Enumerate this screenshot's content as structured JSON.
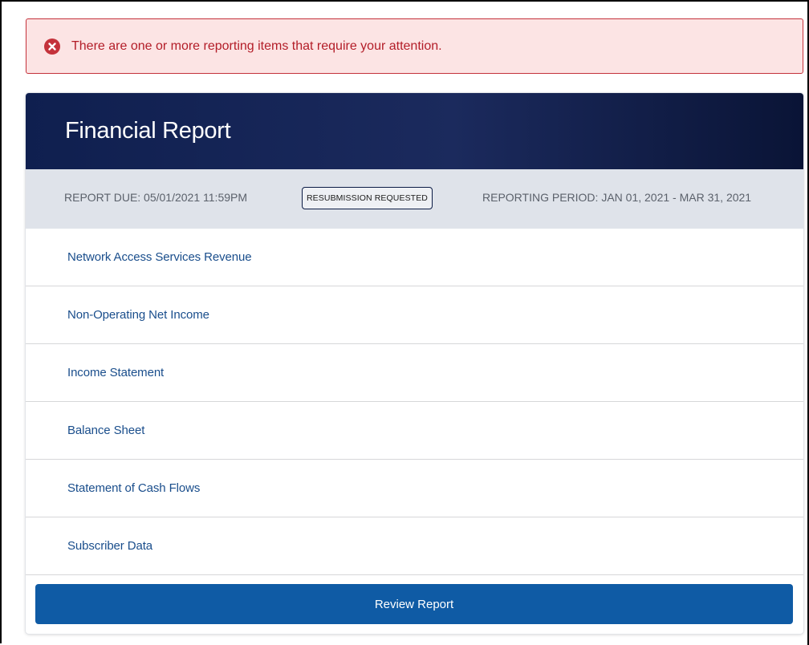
{
  "alert": {
    "icon": "error-circle-icon",
    "message": "There are one or more reporting items that require your attention.",
    "color": "#b31d28",
    "background": "#fce4e4"
  },
  "report": {
    "title": "Financial Report",
    "due": "REPORT DUE: 05/01/2021 11:59PM",
    "status": "RESUBMISSION REQUESTED",
    "period": "REPORTING PERIOD: JAN 01, 2021 - MAR 31, 2021",
    "header_color": "#0f1f4f"
  },
  "items": [
    {
      "label": "Network Access Services Revenue"
    },
    {
      "label": "Non-Operating Net Income"
    },
    {
      "label": "Income Statement"
    },
    {
      "label": "Balance Sheet"
    },
    {
      "label": "Statement of Cash Flows"
    },
    {
      "label": "Subscriber Data"
    }
  ],
  "actions": {
    "review_label": "Review Report",
    "button_color": "#0f5ba5"
  }
}
